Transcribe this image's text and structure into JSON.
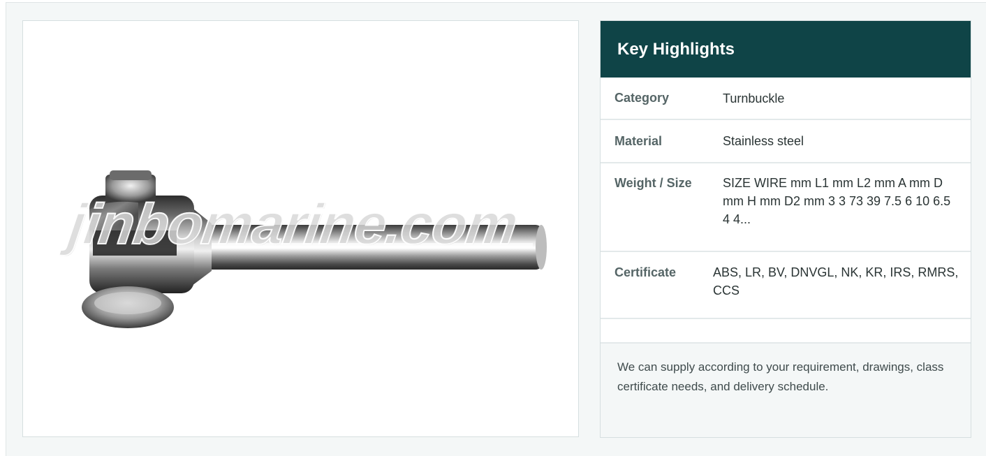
{
  "product_image": {
    "alt": "Stainless steel fork terminal",
    "watermark": "jinbomarine.com"
  },
  "highlights": {
    "title": "Key Highlights",
    "rows": [
      {
        "label": "Category",
        "value": "Turnbuckle"
      },
      {
        "label": "Material",
        "value": "Stainless steel"
      },
      {
        "label": "Weight / Size",
        "value": "SIZE WIRE mm L1 mm L2 mm A mm D mm H mm D2 mm 3 3 73 39 7.5 6 10 6.5 4 4..."
      },
      {
        "label": "Certificate",
        "value": "ABS, LR, BV, DNVGL, NK, KR, IRS, RMRS, CCS"
      }
    ],
    "note": "We can supply according to your requirement, drawings, class certificate needs, and delivery schedule."
  },
  "colors": {
    "header_bg": "#0f4447",
    "panel_bg": "#f4f7f7",
    "label_text": "#556566",
    "value_text": "#2a3434"
  }
}
